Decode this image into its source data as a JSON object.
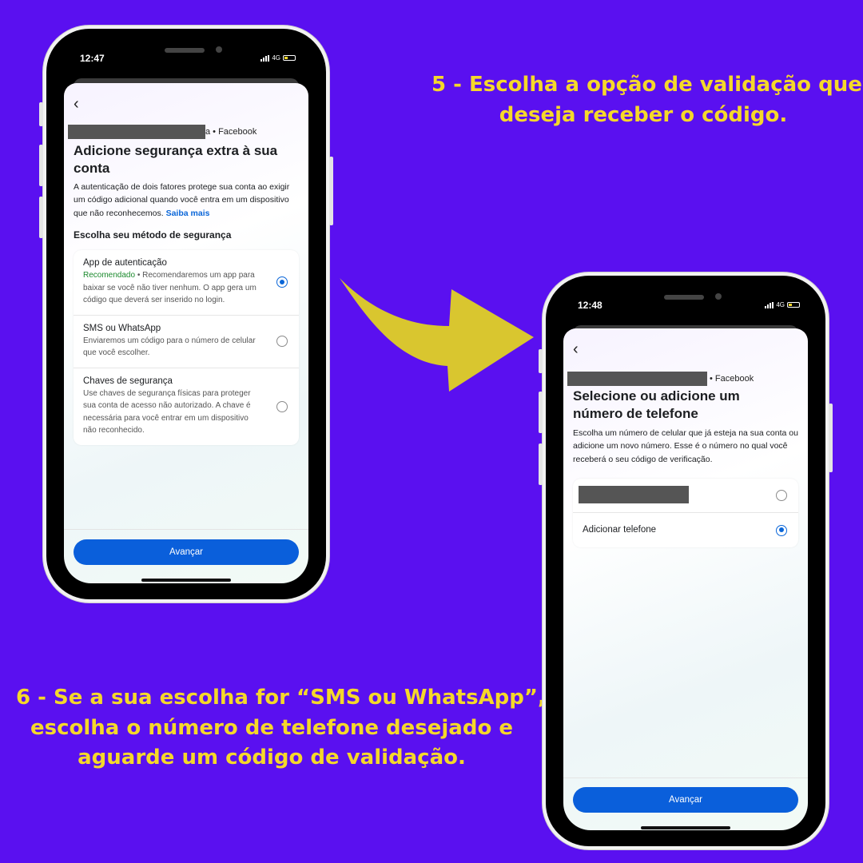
{
  "caption_step5": [
    "5 -  Escolha a opção de validação que",
    "deseja receber o código."
  ],
  "caption_step6": [
    "6 - Se a sua escolha for “SMS ou WhatsApp”,",
    "escolha o número de telefone desejado e",
    "aguarde um código de validação."
  ],
  "colors": {
    "background": "#5a10f0",
    "caption": "#f5d82a",
    "accent": "#0a5fdb",
    "arrow": "#d9c62f",
    "recommended": "#1b8a2d"
  },
  "phone1": {
    "status_time": "12:47",
    "network": "4G",
    "back_icon": "chevron-left-icon",
    "account_suffix": "a • Facebook",
    "title": "Adicione segurança extra à sua conta",
    "description": "A autenticação de dois fatores protege sua conta ao exigir um código adicional quando você entra em um dispositivo que não reconhecemos.",
    "learn_more": "Saiba mais",
    "method_heading": "Escolha seu método de segurança",
    "options": [
      {
        "title": "App de autenticação",
        "badge": "Recomendado",
        "desc": " • Recomendaremos um app para baixar se você não tiver nenhum. O app gera um código que deverá ser inserido no login.",
        "selected": true
      },
      {
        "title": "SMS ou WhatsApp",
        "desc": "Enviaremos um código para o número de celular que você escolher.",
        "selected": false
      },
      {
        "title": "Chaves de segurança",
        "desc": "Use chaves de segurança físicas para proteger sua conta de acesso não autorizado. A chave é necessária para você entrar em um dispositivo não reconhecido.",
        "selected": false
      }
    ],
    "next_button": "Avançar"
  },
  "phone2": {
    "status_time": "12:48",
    "network": "4G",
    "back_icon": "chevron-left-icon",
    "account_suffix": "• Facebook",
    "title": "Selecione ou adicione um número de telefone",
    "description": "Escolha um número de celular que já esteja na sua conta ou adicione um novo número. Esse é o número no qual você receberá o seu código de verificação.",
    "options": [
      {
        "label": "",
        "redacted": true,
        "selected": false
      },
      {
        "label": "Adicionar telefone",
        "selected": true
      }
    ],
    "next_button": "Avançar"
  }
}
